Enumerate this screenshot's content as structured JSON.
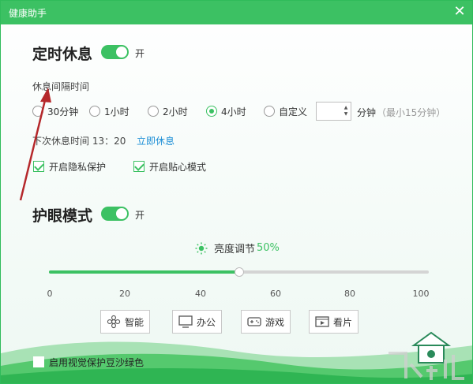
{
  "window": {
    "title": "健康助手",
    "close_icon": "close-icon"
  },
  "rest": {
    "title": "定时休息",
    "toggle_state": "on",
    "toggle_text": "开",
    "interval_label": "休息间隔时间",
    "options": [
      {
        "label": "30分钟",
        "checked": false
      },
      {
        "label": "1小时",
        "checked": false
      },
      {
        "label": "2小时",
        "checked": false
      },
      {
        "label": "4小时",
        "checked": true
      },
      {
        "label": "自定义",
        "checked": false
      }
    ],
    "custom_value": "",
    "custom_unit": "分钟",
    "custom_hint": "（最小15分钟）",
    "next_rest_label": "下次休息时间 13：20",
    "rest_now_link": "立即休息",
    "privacy_label": "开启隐私保护",
    "privacy_checked": true,
    "care_label": "开启贴心模式",
    "care_checked": true
  },
  "eye": {
    "title": "护眼模式",
    "toggle_state": "on",
    "toggle_text": "开",
    "brightness_label": "亮度调节",
    "brightness_value": "50%",
    "brightness_level": 50,
    "ticks": [
      "0",
      "20",
      "40",
      "60",
      "80",
      "100"
    ],
    "modes": [
      {
        "label": "智能",
        "icon": "gear-flower-icon"
      },
      {
        "label": "办公",
        "icon": "monitor-icon"
      },
      {
        "label": "游戏",
        "icon": "gamepad-icon"
      },
      {
        "label": "看片",
        "icon": "video-icon"
      }
    ],
    "green_bean_label": "启用视觉保护豆沙绿色",
    "green_bean_checked": false
  },
  "colors": {
    "accent": "#3cc163",
    "link": "#1e8fd6",
    "arrow": "#b5282b"
  }
}
